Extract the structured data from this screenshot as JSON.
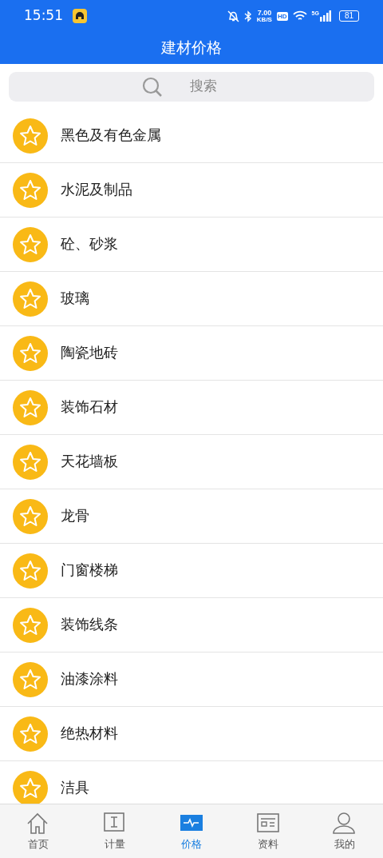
{
  "status_bar": {
    "time": "15:51",
    "speed": "7.00",
    "speed_unit": "KB/S",
    "hd": "HD",
    "network": "5G",
    "battery": "81"
  },
  "title": "建材价格",
  "search": {
    "placeholder": "搜索"
  },
  "categories": [
    {
      "label": "黑色及有色金属"
    },
    {
      "label": "水泥及制品"
    },
    {
      "label": "砼、砂浆"
    },
    {
      "label": "玻璃"
    },
    {
      "label": "陶瓷地砖"
    },
    {
      "label": "装饰石材"
    },
    {
      "label": "天花墙板"
    },
    {
      "label": "龙骨"
    },
    {
      "label": "门窗楼梯"
    },
    {
      "label": "装饰线条"
    },
    {
      "label": "油漆涂料"
    },
    {
      "label": "绝热材料"
    },
    {
      "label": "洁具"
    }
  ],
  "tab_bar": [
    {
      "kind": "home",
      "label": "首页",
      "selected": false
    },
    {
      "kind": "measure",
      "label": "计量",
      "selected": false
    },
    {
      "kind": "price",
      "label": "价格",
      "selected": true
    },
    {
      "kind": "docs",
      "label": "资料",
      "selected": false
    },
    {
      "kind": "user",
      "label": "我的",
      "selected": false
    }
  ]
}
